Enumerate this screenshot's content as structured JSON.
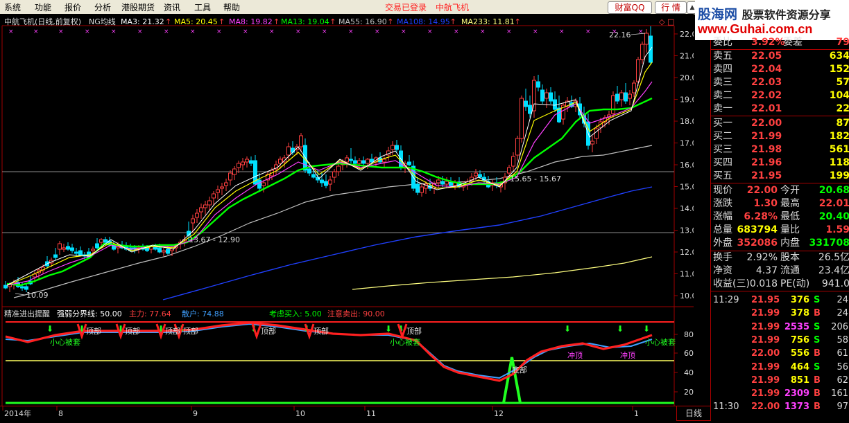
{
  "menu": [
    "系统",
    "功能",
    "报价",
    "分析",
    "港股期货",
    "资讯",
    "工具",
    "帮助"
  ],
  "status_links": [
    "交易已登录",
    "中航飞机"
  ],
  "toolbar": {
    "btn1": "财富QQ",
    "btn2": "行 情",
    "arrow": "▲"
  },
  "logo": {
    "cn": "股海网",
    "slogan": "股票软件资源分享",
    "url": "www.Guhai.com.cn"
  },
  "stock_title": "中航飞机(日线,前复权)",
  "indicator_name": "NG均线",
  "ma_labels": [
    {
      "label": "MA3: 21.32",
      "color": "#ffffff"
    },
    {
      "label": "MA5: 20.45",
      "color": "#ffff00"
    },
    {
      "label": "MA8: 19.82",
      "color": "#ff40ff"
    },
    {
      "label": "MA13: 19.04",
      "color": "#00ff00"
    },
    {
      "label": "MA55: 16.90",
      "color": "#c0c0c0"
    },
    {
      "label": "MA108: 14.95",
      "color": "#2040ff"
    },
    {
      "label": "MA233: 11.81",
      "color": "#ffff80"
    }
  ],
  "price_axis": [
    "22.00",
    "21.00",
    "20.00",
    "19.00",
    "18.00",
    "17.00",
    "16.00",
    "15.00",
    "14.00",
    "13.00",
    "12.00",
    "11.00",
    "10.00"
  ],
  "price_annotations": {
    "high": "22.16",
    "low": "10.09",
    "range1": "13.67 - 12.90",
    "range2": "15.65 - 15.67"
  },
  "indicator2": {
    "title": "精准进出提醒",
    "params": [
      {
        "label": "强弱分界线: 50.00",
        "color": "#ffffff"
      },
      {
        "label": "主力: 77.64",
        "color": "#ff4040"
      },
      {
        "label": "散户: 74.88",
        "color": "#40a0ff"
      },
      {
        "label": "考虑买入: 5.00",
        "color": "#00ff00"
      },
      {
        "label": "注意卖出: 90.00",
        "color": "#ff4040"
      }
    ],
    "axis": [
      "80.00",
      "60.00",
      "40.00",
      "20.00"
    ],
    "marks": {
      "trap": "小心被套",
      "top": "顶部",
      "rush": "冲顶",
      "bottom": "底部"
    }
  },
  "date_axis": [
    "2014年",
    "8",
    "9",
    "10",
    "11",
    "12",
    "1"
  ],
  "period": "日线",
  "quote": {
    "weibi": {
      "label": "委比",
      "value": "3.92%",
      "label2": "委差",
      "value2": "79"
    },
    "sells": [
      {
        "label": "卖五",
        "price": "22.05",
        "vol": "634"
      },
      {
        "label": "卖四",
        "price": "22.04",
        "vol": "152"
      },
      {
        "label": "卖三",
        "price": "22.03",
        "vol": "57"
      },
      {
        "label": "卖二",
        "price": "22.02",
        "vol": "104"
      },
      {
        "label": "卖一",
        "price": "22.01",
        "vol": "22"
      }
    ],
    "buys": [
      {
        "label": "买一",
        "price": "22.00",
        "vol": "87"
      },
      {
        "label": "买二",
        "price": "21.99",
        "vol": "182"
      },
      {
        "label": "买三",
        "price": "21.98",
        "vol": "561"
      },
      {
        "label": "买四",
        "price": "21.96",
        "vol": "118"
      },
      {
        "label": "买五",
        "price": "21.95",
        "vol": "199"
      }
    ],
    "stats": [
      {
        "l1": "现价",
        "v1": "22.00",
        "c1": "#ff4040",
        "l2": "今开",
        "v2": "20.68",
        "c2": "#00ff00"
      },
      {
        "l1": "涨跌",
        "v1": "1.30",
        "c1": "#ff4040",
        "l2": "最高",
        "v2": "22.01",
        "c2": "#ff4040"
      },
      {
        "l1": "涨幅",
        "v1": "6.28%",
        "c1": "#ff4040",
        "l2": "最低",
        "v2": "20.40",
        "c2": "#00ff00"
      },
      {
        "l1": "总量",
        "v1": "683794",
        "c1": "#ffff00",
        "l2": "量比",
        "v2": "1.59",
        "c2": "#ff4040"
      },
      {
        "l1": "外盘",
        "v1": "352086",
        "c1": "#ff4040",
        "l2": "内盘",
        "v2": "331708",
        "c2": "#00ff00"
      }
    ],
    "stats2": [
      {
        "l1": "换手",
        "v1": "2.92%",
        "l2": "股本",
        "v2": "26.5亿"
      },
      {
        "l1": "净资",
        "v1": "4.37",
        "l2": "流通",
        "v2": "23.4亿"
      },
      {
        "l1": "收益(三)",
        "v1": "0.018",
        "l2": "PE(动)",
        "v2": "941.0"
      }
    ],
    "ticks": [
      {
        "time": "11:29",
        "price": "21.95",
        "vol": "376",
        "side": "S",
        "num": "24"
      },
      {
        "time": "",
        "price": "21.99",
        "vol": "378",
        "side": "B",
        "num": "24"
      },
      {
        "time": "",
        "price": "21.99",
        "vol": "2535",
        "side": "S",
        "num": "206"
      },
      {
        "time": "",
        "price": "21.99",
        "vol": "756",
        "side": "S",
        "num": "58"
      },
      {
        "time": "",
        "price": "22.00",
        "vol": "556",
        "side": "B",
        "num": "61"
      },
      {
        "time": "",
        "price": "21.99",
        "vol": "464",
        "side": "S",
        "num": "56"
      },
      {
        "time": "",
        "price": "21.99",
        "vol": "851",
        "side": "B",
        "num": "62"
      },
      {
        "time": "",
        "price": "21.99",
        "vol": "2309",
        "side": "B",
        "num": "161"
      },
      {
        "time": "11:30",
        "price": "22.00",
        "vol": "1373",
        "side": "B",
        "num": "97"
      }
    ]
  },
  "colors": {
    "up": "#ff4040",
    "down": "#00ffff",
    "ma13": "#00ff00",
    "ma55": "#c0c0c0",
    "ma108": "#2040ff",
    "ma233": "#ffff80",
    "border": "#a00000"
  }
}
